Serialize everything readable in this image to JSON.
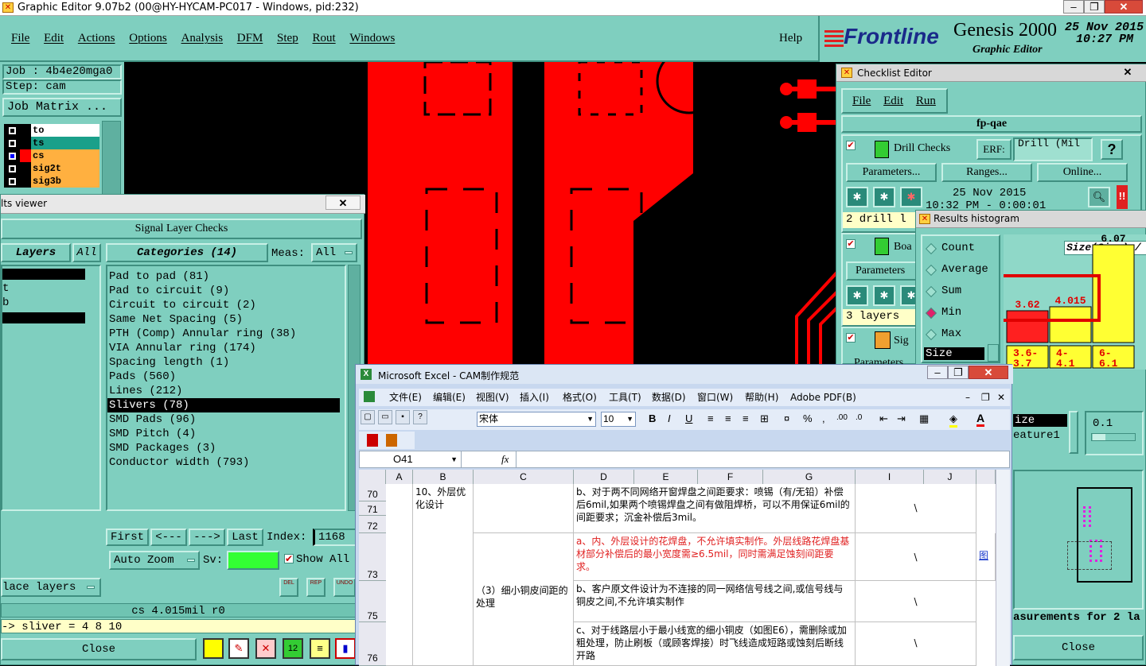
{
  "main_window": {
    "title": "Graphic Editor 9.07b2 (00@HY-HYCAM-PC017 - Windows, pid:232)",
    "menu": [
      "File",
      "Edit",
      "Actions",
      "Options",
      "Analysis",
      "DFM",
      "Step",
      "Rout",
      "Windows"
    ],
    "help": "Help",
    "brand": "Frontline",
    "product": "Genesis 2000",
    "subtitle": "Graphic Editor",
    "date": "25 Nov 2015",
    "time": "10:27 PM",
    "job": "Job : 4b4e20mga0",
    "step": "Step: cam",
    "job_matrix": "Job Matrix ...",
    "layers": [
      {
        "name": "to",
        "color": "#ffffff"
      },
      {
        "name": "ts",
        "color": "#1aa08a"
      },
      {
        "name": "cs",
        "color": "#ffb040"
      },
      {
        "name": "sig2t",
        "color": "#ffb040"
      },
      {
        "name": "sig3b",
        "color": "#ffb040"
      }
    ]
  },
  "results_viewer": {
    "title": "lts viewer",
    "header": "Signal Layer Checks",
    "layers_label": "Layers",
    "all_label": "All",
    "left_rows": [
      "t",
      "b"
    ],
    "categories_label": "Categories (14)",
    "meas_label": "Meas:",
    "meas_value": "All",
    "categories": [
      "Pad to pad (81)",
      "Pad to circuit (9)",
      "Circuit to circuit (2)",
      "Same Net Spacing (5)",
      "PTH (Comp) Annular ring (38)",
      "VIA Annular ring (174)",
      "Spacing length (1)",
      "Pads (560)",
      "Lines (212)",
      "Slivers (78)",
      "SMD Pads (96)",
      "SMD Pitch (4)",
      "SMD Packages (3)",
      "Conductor width (793)"
    ],
    "selected_index": 9,
    "nav": {
      "first": "First",
      "prev": "<---",
      "next": "--->",
      "last": "Last",
      "index_label": "Index:",
      "index_value": "1168"
    },
    "auto_zoom": "Auto Zoom",
    "sv_label": "Sv:",
    "show_all": "Show All",
    "place_layers": "lace layers",
    "icons": [
      "DEL",
      "REP",
      "UNDO"
    ],
    "status1": "cs 4.015mil  r0",
    "status2": "-> sliver = 4 8 10",
    "close": "Close"
  },
  "checklist": {
    "title": "Checklist Editor",
    "menu": [
      "File",
      "Edit",
      "Run"
    ],
    "name": "fp-qae",
    "drill_checks": "Drill Checks",
    "erf_label": "ERF:",
    "erf_value": "Drill (Mil",
    "help_btn": "?",
    "buttons": [
      "Parameters...",
      "Ranges...",
      "Online..."
    ],
    "run_date": "25 Nov 2015",
    "run_time": "10:32 PM - 0:00:01",
    "drill_summary": "2 drill l",
    "board_label": "Boa",
    "parameters2": "Parameters",
    "layers_summary": "3 layers",
    "signal_label": "Sig",
    "parameters3": "Parameters",
    "size_label2": "ize",
    "feature_label": "eature1",
    "value_01": "0.1",
    "measure_text": "asurements for 2 la",
    "close": "Close"
  },
  "histogram": {
    "title": "Results histogram",
    "options": [
      "Count",
      "Average",
      "Sum",
      "Min",
      "Max"
    ],
    "selected": "Min",
    "size_label": "Size",
    "chart_title": "Size(Size) /",
    "bins": [
      "3.6-3.7",
      "4-4.1",
      "6-6.1"
    ],
    "values": [
      3.62,
      4.015,
      6.07
    ],
    "value_labels": [
      "3.62",
      "4.015",
      "6.07"
    ],
    "bin_colors": [
      "#ff2020",
      "#ffff33",
      "#ffff33"
    ]
  },
  "excel": {
    "title": "Microsoft Excel - CAM制作规范",
    "menu": [
      "文件(E)",
      "编辑(E)",
      "视图(V)",
      "插入(I)",
      "格式(O)",
      "工具(T)",
      "数据(D)",
      "窗口(W)",
      "帮助(H)",
      "Adobe PDF(B)"
    ],
    "font": "宋体",
    "size": "10",
    "name_box": "O41",
    "fx": "fx",
    "columns": [
      "A",
      "B",
      "C",
      "D",
      "E",
      "F",
      "G",
      "I",
      "J"
    ],
    "rows": [
      "70",
      "71",
      "72",
      "73",
      "75",
      "76"
    ],
    "b_text": "10、外层优化设计",
    "c_text": "（3）细小铜皮间距的处理",
    "d_row1": "b、对于两不同网络开窗焊盘之间距要求：喷锡（有/无铅）补偿后6mil,如果两个喷锡焊盘之间有做阻焊桥，可以不用保证6mil的间距要求；沉金补偿后3mil。",
    "d_row2": "a、内、外层设计的花焊盘，不允许填实制作。外层线路花焊盘基材部分补偿后的最小宽度需≥6.5mil，同时需满足蚀刻间距要求。",
    "d_row3": "b、客户原文件设计为不连接的同一网络信号线之间,或信号线与铜皮之间,不允许填实制作",
    "d_row4": "c、对于线路层小于最小线宽的细小铜皮（如图E6），需删除或加粗处理，防止刷板（或顾客焊接）时飞线造成短路或蚀刻后断线开路",
    "backslash": "\\",
    "fig": "图"
  }
}
